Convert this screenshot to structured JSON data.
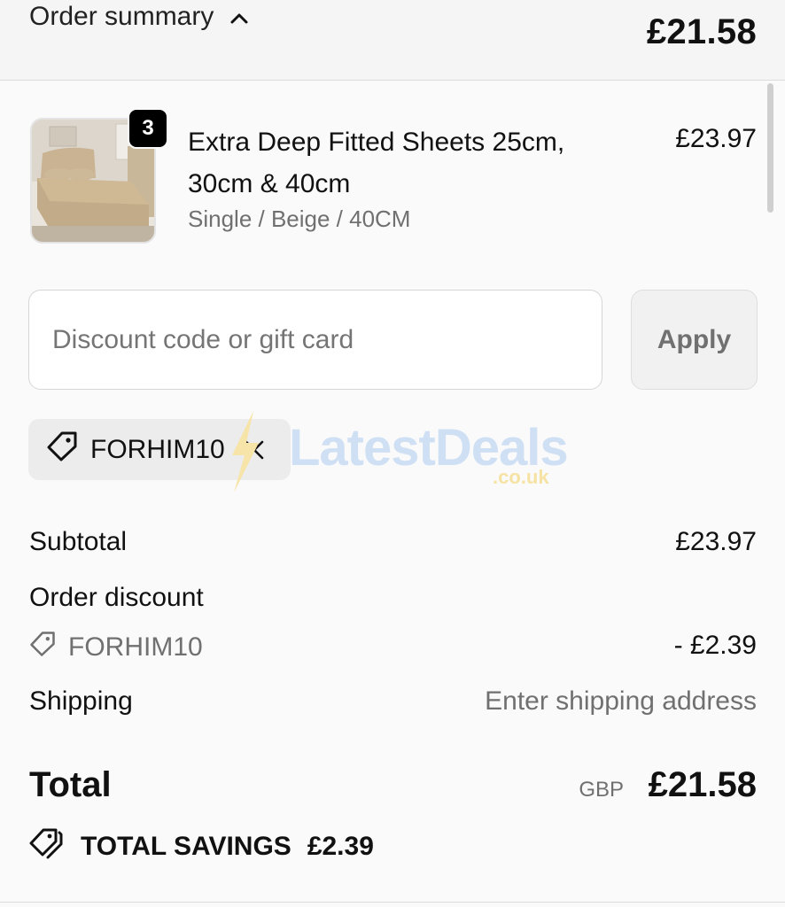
{
  "header": {
    "title": "Order summary",
    "total": "£21.58"
  },
  "item": {
    "quantity": "3",
    "title": "Extra Deep Fitted Sheets 25cm, 30cm & 40cm",
    "variant": "Single / Beige / 40CM",
    "price": "£23.97"
  },
  "discount": {
    "placeholder": "Discount code or gift card",
    "apply_label": "Apply",
    "applied_code": "FORHIM10"
  },
  "watermark": {
    "text": "LatestDeals",
    "sub": ".co.uk"
  },
  "summary": {
    "subtotal_label": "Subtotal",
    "subtotal_value": "£23.97",
    "order_discount_label": "Order discount",
    "discount_code": "FORHIM10",
    "discount_value": "- £2.39",
    "shipping_label": "Shipping",
    "shipping_value": "Enter shipping address",
    "total_label": "Total",
    "currency": "GBP",
    "total_value": "£21.58",
    "savings_label": "TOTAL SAVINGS",
    "savings_value": "£2.39"
  },
  "colors": {
    "background": "#f5f5f5",
    "panel": "#fafafa",
    "text": "#111111",
    "muted": "#707070",
    "badge": "#000000"
  }
}
